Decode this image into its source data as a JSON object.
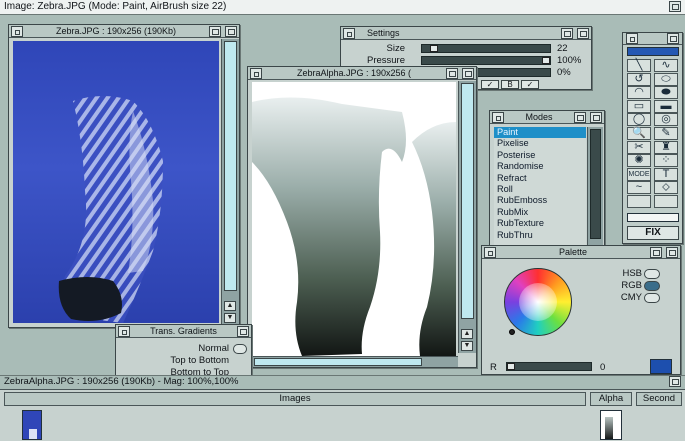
{
  "screen_title": "Image: Zebra.JPG (Mode: Paint, AirBrush size 22)",
  "zebra_window": {
    "title": "Zebra.JPG : 190x256 (190Kb)"
  },
  "alpha_window": {
    "title": "ZebraAlpha.JPG : 190x256 ("
  },
  "settings": {
    "title": "Settings",
    "rows": [
      {
        "label": "Size",
        "value": "22",
        "level": 0.08
      },
      {
        "label": "Pressure",
        "value": "100%",
        "level": 1.0
      },
      {
        "label": "",
        "value": "0%",
        "level": 0.0
      }
    ],
    "buttons": [
      "✓",
      "B",
      "✓"
    ]
  },
  "modes": {
    "title": "Modes",
    "items": [
      "Paint",
      "Pixelise",
      "Posterise",
      "Randomise",
      "Refract",
      "Roll",
      "RubEmboss",
      "RubMix",
      "RubTexture",
      "RubThru"
    ],
    "selected": "Paint"
  },
  "palette": {
    "title": "Palette",
    "models": [
      {
        "label": "HSB",
        "on": false
      },
      {
        "label": "RGB",
        "on": true
      },
      {
        "label": "CMY",
        "on": false
      }
    ],
    "channel_label": "R",
    "channel_value": "0",
    "current_color": "#1d4fae"
  },
  "trans_gradients": {
    "title": "Trans. Gradients",
    "items": [
      "Normal",
      "Top to Bottom",
      "Bottom to Top"
    ]
  },
  "toolbox": {
    "tools": [
      "line-tool",
      "curve-tool",
      "freehand-tool",
      "ellipse-tool",
      "arc-tool",
      "filled-ellipse-tool",
      "rectangle-tool",
      "filled-rect-tool",
      "ellipse-outline-tool",
      "ring-tool",
      "magnify-tool",
      "pen-tool",
      "scissors-tool",
      "brush-tool",
      "airbrush-tool",
      "spray-tool",
      "mode-tool",
      "text-tool",
      "smudge-tool",
      "fill-tool",
      "blank-tool",
      "blank-tool-2"
    ],
    "mode_label": "MODE",
    "fix_label": "FIX"
  },
  "status": {
    "text": "ZebraAlpha.JPG : 190x256 (190Kb) - Mag: 100%,100%"
  },
  "images_panel": {
    "header": "Images",
    "columns": [
      "Alpha",
      "Second"
    ]
  }
}
